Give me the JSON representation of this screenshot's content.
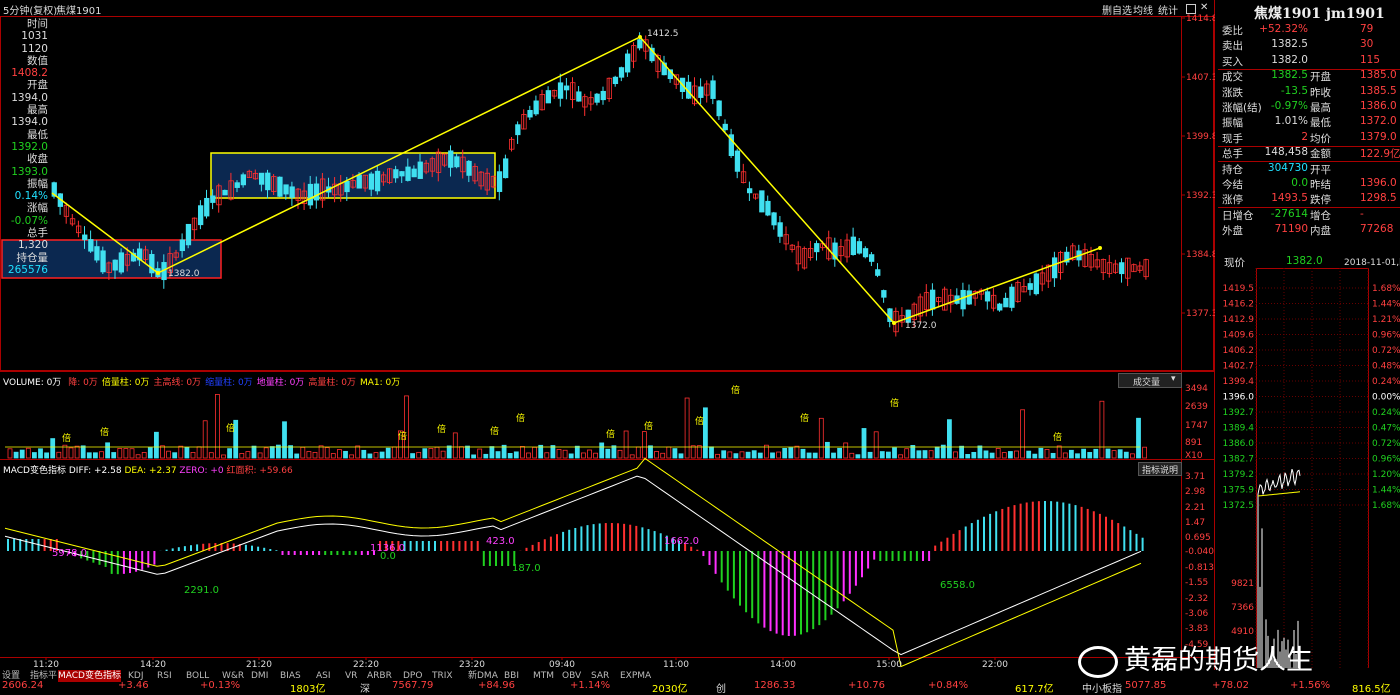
{
  "window": {
    "period_label": "5分钟(复权)",
    "symbol": "焦煤1901",
    "right_buttons": [
      "删自选",
      "均线",
      "统计"
    ],
    "sq_icon": "square-icon",
    "close_icon": "close-icon"
  },
  "info": {
    "rows": [
      {
        "label": "时间",
        "value": ""
      },
      {
        "label": "1031",
        "value": ""
      },
      {
        "label": "1120",
        "value": ""
      },
      {
        "label": "数值",
        "value": ""
      },
      {
        "label": "1408.2",
        "value": "",
        "color": "#ff4040"
      },
      {
        "label": "开盘",
        "value": ""
      },
      {
        "label": "1394.0",
        "value": ""
      },
      {
        "label": "最高",
        "value": ""
      },
      {
        "label": "1394.0",
        "value": ""
      },
      {
        "label": "最低",
        "value": ""
      },
      {
        "label": "1392.0",
        "value": "",
        "color": "#20d020"
      },
      {
        "label": "收盘",
        "value": ""
      },
      {
        "label": "1393.0",
        "value": "",
        "color": "#20d020"
      },
      {
        "label": "振幅",
        "value": ""
      },
      {
        "label": "0.14%",
        "value": "",
        "color": "#20e0ff"
      },
      {
        "label": "涨幅",
        "value": ""
      },
      {
        "label": "-0.07%",
        "value": "",
        "color": "#20d020"
      },
      {
        "label": "总手",
        "value": ""
      },
      {
        "label": "1,320",
        "value": ""
      },
      {
        "label": "持仓量",
        "value": ""
      },
      {
        "label": "265576",
        "value": "",
        "color": "#20e0ff"
      }
    ]
  },
  "price_axis": [
    "1414.8",
    "1407.3",
    "1399.8",
    "1392.3",
    "1384.8",
    "1377.3"
  ],
  "annotations": {
    "high": "1412.5",
    "low_left": "1382.0",
    "low_right": "1372.0"
  },
  "volume": {
    "header_label": "VOLUME: 0万",
    "legend": [
      {
        "text": "降: 0万",
        "color": "#ff4040"
      },
      {
        "text": "倍量柱: 0万",
        "color": "#ffff00"
      },
      {
        "text": "主高线: 0万",
        "color": "#ff4040"
      },
      {
        "text": "缩量柱: 0万",
        "color": "#2040ff"
      },
      {
        "text": "地量柱: 0万",
        "color": "#ff40ff"
      },
      {
        "text": "高量柱: 0万",
        "color": "#ff4040"
      },
      {
        "text": "MA1: 0万",
        "color": "#ffff00"
      }
    ],
    "dropdown": "成交量",
    "axis": [
      "3494",
      "2639",
      "1747",
      "891",
      "X10"
    ],
    "marker": "倍"
  },
  "macd": {
    "header": "MACD变色指标",
    "diff": "DIFF: +2.58",
    "dea": "DEA: +2.37",
    "zero": "ZERO: +0",
    "red": "红面积: +59.66",
    "help_button": "指标说明",
    "axis": [
      "3.71",
      "2.98",
      "2.21",
      "1.47",
      "0.695",
      "-0.040",
      "-0.813",
      "-1.55",
      "-2.32",
      "-3.06",
      "-3.83",
      "-4.59"
    ],
    "area_labels": [
      {
        "text": "5978.0",
        "color": "#ff40ff"
      },
      {
        "text": "2291.0",
        "color": "#20d020"
      },
      {
        "text": "1136.0",
        "color": "#ff40ff"
      },
      {
        "text": "0.0",
        "color": "#20d020"
      },
      {
        "text": "423.0",
        "color": "#ff40ff"
      },
      {
        "text": "187.0",
        "color": "#20d020"
      },
      {
        "text": "1662.0",
        "color": "#ff40ff"
      },
      {
        "text": "6558.0",
        "color": "#20d020"
      }
    ]
  },
  "time_axis": [
    "11:20",
    "14:20",
    "21:20",
    "22:20",
    "23:20",
    "09:40",
    "11:00",
    "14:00",
    "15:00",
    "22:00"
  ],
  "quote": {
    "title": "焦煤1901 jm1901",
    "rows": [
      {
        "l": "委比",
        "v": "+52.32%",
        "vc": "#ff4040",
        "l2": "",
        "v2": "79"
      },
      {
        "l": "卖出",
        "v": "1382.5",
        "vc": "#dddddd",
        "l2": "",
        "v2": "30"
      },
      {
        "l": "买入",
        "v": "1382.0",
        "vc": "#dddddd",
        "l2": "",
        "v2": "115"
      },
      {
        "l": "成交",
        "v": "1382.5",
        "vc": "#20d020",
        "l2": "开盘",
        "v2": "1385.0"
      },
      {
        "l": "涨跌",
        "v": "-13.5",
        "vc": "#20d020",
        "l2": "昨收",
        "v2": "1385.5"
      },
      {
        "l": "涨幅(结)",
        "v": "-0.97%",
        "vc": "#20d020",
        "l2": "最高",
        "v2": "1386.0"
      },
      {
        "l": "振幅",
        "v": "1.01%",
        "vc": "#dddddd",
        "l2": "最低",
        "v2": "1372.0"
      },
      {
        "l": "现手",
        "v": "2",
        "vc": "#ff4040",
        "l2": "均价",
        "v2": "1379.0"
      },
      {
        "l": "总手",
        "v": "148,458",
        "vc": "#dddddd",
        "l2": "金额",
        "v2": "122.9亿"
      },
      {
        "l": "持仓",
        "v": "304730",
        "vc": "#20e0ff",
        "l2": "开平",
        "v2": ""
      },
      {
        "l": "今结",
        "v": "0.0",
        "vc": "#20d020",
        "l2": "昨结",
        "v2": "1396.0"
      },
      {
        "l": "涨停",
        "v": "1493.5",
        "vc": "#ff4040",
        "l2": "跌停",
        "v2": "1298.5"
      },
      {
        "l": "日增仓",
        "v": "-27614",
        "vc": "#20d020",
        "l2": "增仓",
        "v2": "-"
      },
      {
        "l": "外盘",
        "v": "71190",
        "vc": "#ff4040",
        "l2": "内盘",
        "v2": "77268"
      }
    ],
    "current_label": "现价",
    "current_value": "1382.0",
    "datetime": "2018-11-01,四"
  },
  "mini_axis_left": [
    "1419.5",
    "1416.2",
    "1412.9",
    "1409.6",
    "1406.2",
    "1402.7",
    "1399.4",
    "1396.0",
    "1392.7",
    "1389.4",
    "1386.0",
    "1382.7",
    "1379.2",
    "1375.9",
    "1372.5",
    "9821",
    "7366",
    "4910"
  ],
  "mini_axis_right": [
    "1.68%",
    "1.44%",
    "1.21%",
    "0.96%",
    "0.72%",
    "0.48%",
    "0.24%",
    "0.00%",
    "0.24%",
    "0.47%",
    "0.72%",
    "0.96%",
    "1.20%",
    "1.44%",
    "1.68%"
  ],
  "tabs": [
    "设置",
    "指标平台",
    "MACD变色指标",
    "KDJ",
    "RSI",
    "BOLL",
    "W&R",
    "DMI",
    "BIAS",
    "ASI",
    "VR",
    "ARBR",
    "DPO",
    "TRIX",
    "新DMA",
    "BBI",
    "MTM",
    "OBV",
    "SAR",
    "EXPMA"
  ],
  "status": [
    {
      "t": "2606.24",
      "c": "#ff4040"
    },
    {
      "t": "+3.46",
      "c": "#ff4040"
    },
    {
      "t": "+0.13%",
      "c": "#ff4040"
    },
    {
      "t": "1803亿",
      "c": "#ffff00"
    },
    {
      "t": "深",
      "c": "#dddddd"
    },
    {
      "t": "7567.79",
      "c": "#ff4040"
    },
    {
      "t": "+84.96",
      "c": "#ff4040"
    },
    {
      "t": "+1.14%",
      "c": "#ff4040"
    },
    {
      "t": "2030亿",
      "c": "#ffff00"
    },
    {
      "t": "创",
      "c": "#dddddd"
    },
    {
      "t": "1286.33",
      "c": "#ff4040"
    },
    {
      "t": "+10.76",
      "c": "#ff4040"
    },
    {
      "t": "+0.84%",
      "c": "#ff4040"
    },
    {
      "t": "617.7亿",
      "c": "#ffff00"
    },
    {
      "t": "中小板指",
      "c": "#dddddd"
    },
    {
      "t": "5077.85",
      "c": "#ff4040"
    },
    {
      "t": "+78.02",
      "c": "#ff4040"
    },
    {
      "t": "+1.56%",
      "c": "#ff4040"
    },
    {
      "t": "816.5亿",
      "c": "#ffff00"
    }
  ],
  "watermark": "黄磊的期货人生"
}
